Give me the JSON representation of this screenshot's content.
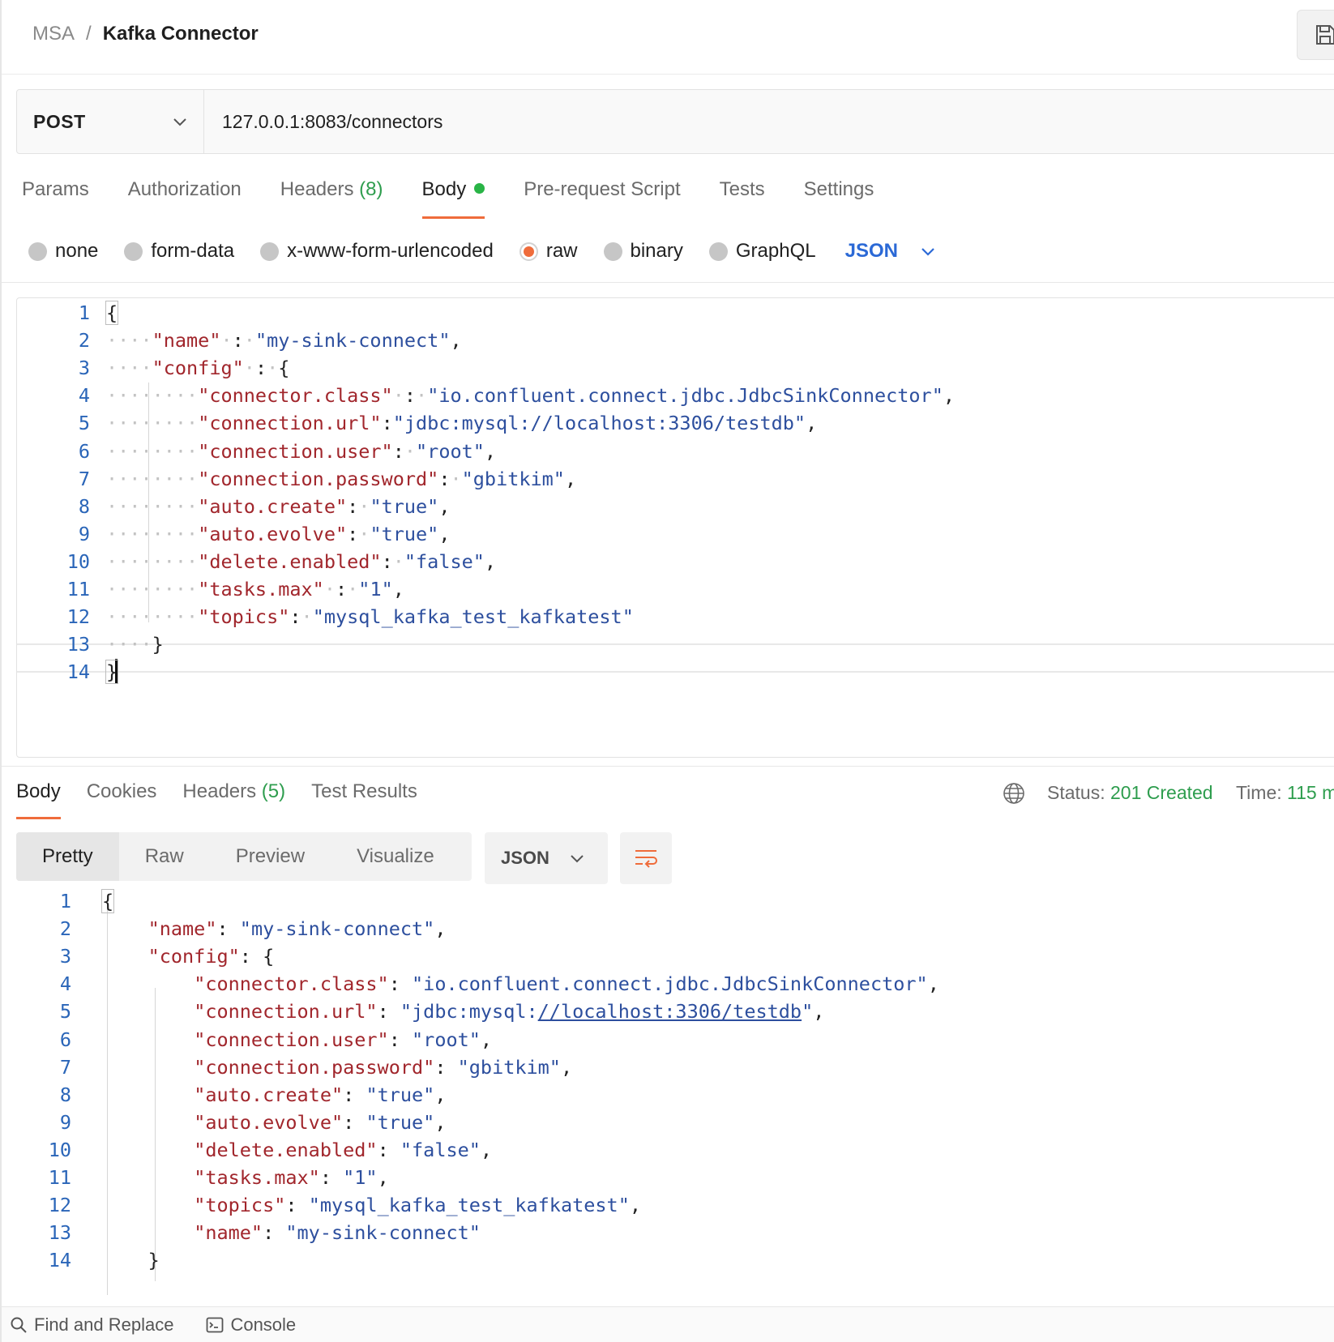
{
  "breadcrumb": {
    "parent": "MSA",
    "separator": "/",
    "current": "Kafka Connector"
  },
  "request": {
    "method": "POST",
    "url": "127.0.0.1:8083/connectors"
  },
  "request_tabs": [
    {
      "label": "Params",
      "count": ""
    },
    {
      "label": "Authorization",
      "count": ""
    },
    {
      "label": "Headers",
      "count": "(8)"
    },
    {
      "label": "Body",
      "count": ""
    },
    {
      "label": "Pre-request Script",
      "count": ""
    },
    {
      "label": "Tests",
      "count": ""
    },
    {
      "label": "Settings",
      "count": ""
    }
  ],
  "body_types": [
    "none",
    "form-data",
    "x-www-form-urlencoded",
    "raw",
    "binary",
    "GraphQL"
  ],
  "body_type_selected": "raw",
  "body_language": "JSON",
  "colors": {
    "accent": "#ef6c3b",
    "success": "#2e9d4e",
    "link": "#2b69d6",
    "key": "#a1262c",
    "string": "#2d4f9e"
  },
  "request_body_lines": [
    [
      "1",
      "{",
      "",
      "",
      "",
      ""
    ],
    [
      "2",
      "····",
      "\"name\"",
      "·:·",
      "\"my-sink-connect\"",
      ","
    ],
    [
      "3",
      "····",
      "\"config\"",
      "·:·",
      "{",
      ""
    ],
    [
      "4",
      "········",
      "\"connector.class\"",
      "·:·",
      "\"io.confluent.connect.jdbc.JdbcSinkConnector\"",
      ","
    ],
    [
      "5",
      "········",
      "\"connection.url\"",
      ":",
      "\"jdbc:mysql://localhost:3306/testdb\"",
      ","
    ],
    [
      "6",
      "········",
      "\"connection.user\"",
      ":·",
      "\"root\"",
      ","
    ],
    [
      "7",
      "········",
      "\"connection.password\"",
      ":·",
      "\"gbitkim\"",
      ","
    ],
    [
      "8",
      "········",
      "\"auto.create\"",
      ":·",
      "\"true\"",
      ","
    ],
    [
      "9",
      "········",
      "\"auto.evolve\"",
      ":·",
      "\"true\"",
      ","
    ],
    [
      "10",
      "········",
      "\"delete.enabled\"",
      ":·",
      "\"false\"",
      ","
    ],
    [
      "11",
      "········",
      "\"tasks.max\"",
      "·:·",
      "\"1\"",
      ","
    ],
    [
      "12",
      "········",
      "\"topics\"",
      ":·",
      "\"mysql_kafka_test_kafkatest\"",
      ""
    ],
    [
      "13",
      "····",
      "}",
      "",
      "",
      ""
    ],
    [
      "14",
      "}",
      "",
      "",
      "",
      ""
    ]
  ],
  "response_tabs": [
    {
      "label": "Body",
      "count": ""
    },
    {
      "label": "Cookies",
      "count": ""
    },
    {
      "label": "Headers",
      "count": "(5)"
    },
    {
      "label": "Test Results",
      "count": ""
    }
  ],
  "response_status": {
    "status_label": "Status:",
    "status_value": "201 Created",
    "time_label": "Time:",
    "time_value": "115 m"
  },
  "response_views": [
    "Pretty",
    "Raw",
    "Preview",
    "Visualize"
  ],
  "response_view_selected": "Pretty",
  "response_format": "JSON",
  "response_body_lines": [
    [
      "1",
      "{",
      "",
      "",
      "",
      ""
    ],
    [
      "2",
      "    ",
      "\"name\"",
      ": ",
      "\"my-sink-connect\"",
      ","
    ],
    [
      "3",
      "    ",
      "\"config\"",
      ": ",
      "{",
      ""
    ],
    [
      "4",
      "        ",
      "\"connector.class\"",
      ": ",
      "\"io.confluent.connect.jdbc.JdbcSinkConnector\"",
      ","
    ],
    [
      "5",
      "        ",
      "\"connection.url\"",
      ": ",
      "\"jdbc:mysql://localhost:3306/testdb\"",
      ","
    ],
    [
      "6",
      "        ",
      "\"connection.user\"",
      ": ",
      "\"root\"",
      ","
    ],
    [
      "7",
      "        ",
      "\"connection.password\"",
      ": ",
      "\"gbitkim\"",
      ","
    ],
    [
      "8",
      "        ",
      "\"auto.create\"",
      ": ",
      "\"true\"",
      ","
    ],
    [
      "9",
      "        ",
      "\"auto.evolve\"",
      ": ",
      "\"true\"",
      ","
    ],
    [
      "10",
      "        ",
      "\"delete.enabled\"",
      ": ",
      "\"false\"",
      ","
    ],
    [
      "11",
      "        ",
      "\"tasks.max\"",
      ": ",
      "\"1\"",
      ","
    ],
    [
      "12",
      "        ",
      "\"topics\"",
      ": ",
      "\"mysql_kafka_test_kafkatest\"",
      ","
    ],
    [
      "13",
      "        ",
      "\"name\"",
      ": ",
      "\"my-sink-connect\"",
      ""
    ],
    [
      "14",
      "    ",
      "}",
      "",
      "",
      ""
    ]
  ],
  "footer": {
    "find_replace": "Find and Replace",
    "console": "Console"
  },
  "icons": {
    "save": "save-icon",
    "method_chevron": "chevron-down-icon",
    "globe": "globe-icon",
    "wrap": "wrap-lines-icon",
    "search": "search-icon",
    "console": "console-icon"
  }
}
